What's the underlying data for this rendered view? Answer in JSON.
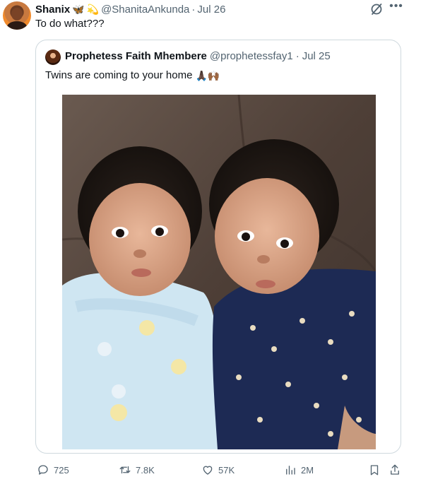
{
  "post": {
    "author_name": "Shanix",
    "author_emojis": [
      "🦋",
      "💫"
    ],
    "handle": "@ShanitaAnkunda",
    "separator": "·",
    "date": "Jul 26",
    "text": "To do what???"
  },
  "quoted": {
    "author_name": "Prophetess Faith Mhembere",
    "handle": "@prophetessfay1",
    "separator": "·",
    "date": "Jul 25",
    "text": "Twins are coming to your home",
    "emojis": "🙏🏿🙌🏾"
  },
  "actions": {
    "replies": "725",
    "reposts": "7.8K",
    "likes": "57K",
    "views": "2M"
  },
  "icons": {
    "more": "more-icon",
    "grok": "grok-icon",
    "reply": "reply-icon",
    "repost": "repost-icon",
    "like": "heart-icon",
    "views": "views-icon",
    "bookmark": "bookmark-icon",
    "share": "share-icon"
  },
  "colors": {
    "text": "#0f1419",
    "secondary": "#536471",
    "border": "#cfd9de"
  }
}
